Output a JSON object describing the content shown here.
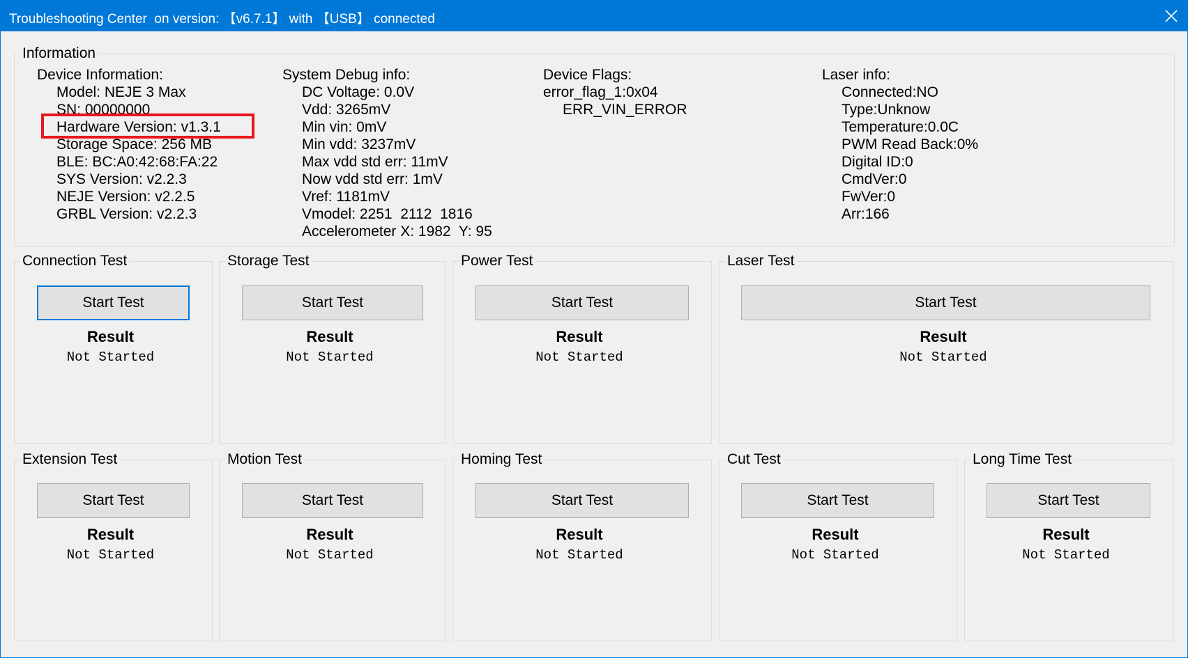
{
  "window": {
    "title": "Troubleshooting Center  on version: 【v6.7.1】 with 【USB】 connected",
    "accent_color": "#0078d7",
    "close_icon": "close-icon"
  },
  "information": {
    "label": "Information",
    "device": {
      "heading": "Device Information:",
      "lines": [
        "Model: NEJE 3 Max",
        "SN: 00000000",
        "Hardware Version: v1.3.1",
        "Storage Space: 256 MB",
        "BLE: BC:A0:42:68:FA:22",
        "SYS Version: v2.2.3",
        "NEJE Version: v2.2.5",
        "GRBL Version: v2.2.3"
      ]
    },
    "debug": {
      "heading": "System Debug info:",
      "lines": [
        "DC Voltage: 0.0V",
        "Vdd: 3265mV",
        "Min vin: 0mV",
        "Min vdd: 3237mV",
        "Max vdd std err: 11mV",
        "Now vdd std err: 1mV",
        "Vref: 1181mV",
        "Vmodel: 2251  2112  1816",
        "Accelerometer X: 1982  Y: 95"
      ]
    },
    "flags": {
      "heading": "Device Flags:",
      "line1": "error_flag_1:0x04",
      "line2": "ERR_VIN_ERROR"
    },
    "laser": {
      "heading": "Laser info:",
      "lines": [
        "Connected:NO",
        "Type:Unknow",
        "Temperature:0.0C",
        "PWM Read Back:0%",
        "Digital ID:0",
        "CmdVer:0",
        "FwVer:0",
        "Arr:166"
      ]
    }
  },
  "tests": {
    "connection": {
      "label": "Connection Test",
      "button": "Start Test",
      "result_label": "Result",
      "result": "Not Started"
    },
    "storage": {
      "label": "Storage Test",
      "button": "Start Test",
      "result_label": "Result",
      "result": "Not Started"
    },
    "power": {
      "label": "Power Test",
      "button": "Start Test",
      "result_label": "Result",
      "result": "Not Started"
    },
    "laser": {
      "label": "Laser Test",
      "button": "Start Test",
      "result_label": "Result",
      "result": "Not Started"
    },
    "extension": {
      "label": "Extension Test",
      "button": "Start Test",
      "result_label": "Result",
      "result": "Not Started"
    },
    "motion": {
      "label": "Motion Test",
      "button": "Start Test",
      "result_label": "Result",
      "result": "Not Started"
    },
    "homing": {
      "label": "Homing Test",
      "button": "Start Test",
      "result_label": "Result",
      "result": "Not Started"
    },
    "cut": {
      "label": "Cut Test",
      "button": "Start Test",
      "result_label": "Result",
      "result": "Not Started"
    },
    "longtime": {
      "label": "Long Time Test",
      "button": "Start Test",
      "result_label": "Result",
      "result": "Not Started"
    }
  },
  "annotation": {
    "highlight_color": "#e8161d"
  }
}
